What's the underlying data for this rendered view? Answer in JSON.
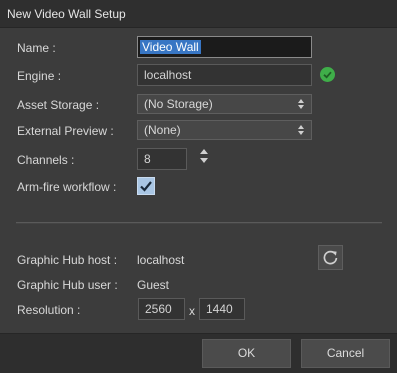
{
  "dialog": {
    "title": "New Video Wall Setup"
  },
  "form": {
    "name_label": "Name :",
    "name_value": "Video Wall",
    "engine_label": "Engine :",
    "engine_value": "localhost",
    "engine_status": "connected",
    "engine_status_color": "#3fae49",
    "asset_storage_label": "Asset Storage :",
    "asset_storage_value": "(No Storage)",
    "external_preview_label": "External Preview :",
    "external_preview_value": "(None)",
    "channels_label": "Channels :",
    "channels_value": "8",
    "arm_fire_label": "Arm-fire workflow :",
    "arm_fire_checked": true
  },
  "hub": {
    "host_label": "Graphic Hub host :",
    "host_value": "localhost",
    "user_label": "Graphic Hub user :",
    "user_value": "Guest",
    "refresh_icon": "refresh-icon"
  },
  "resolution": {
    "label": "Resolution :",
    "width": "2560",
    "separator": "x",
    "height": "1440"
  },
  "footer": {
    "ok_label": "OK",
    "cancel_label": "Cancel"
  },
  "colors": {
    "selection": "#3876c4",
    "checkbox": "#a9c6e4"
  }
}
